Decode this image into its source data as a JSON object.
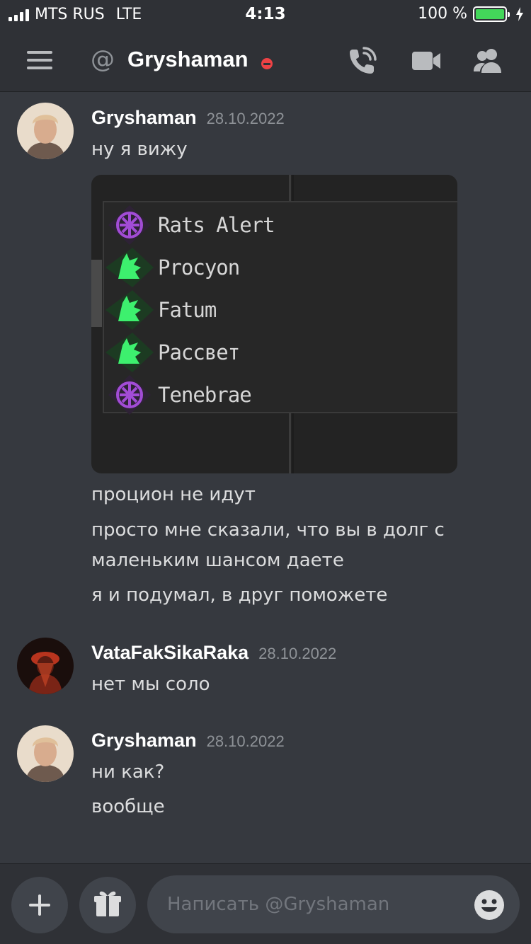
{
  "status_bar": {
    "carrier": "MTS RUS",
    "network": "LTE",
    "time": "4:13",
    "battery_text": "100 %",
    "battery_level": 1.0,
    "battery_color": "#43d65a"
  },
  "header": {
    "title": "Gryshaman",
    "status": "do-not-disturb",
    "status_color": "#ed4245",
    "icons": [
      "hamburger-icon",
      "at-icon",
      "call-icon",
      "video-icon",
      "members-icon"
    ]
  },
  "messages": [
    {
      "author": "Gryshaman",
      "timestamp": "28.10.2022",
      "lines": [
        "ну я вижу"
      ],
      "image": {
        "items": [
          {
            "name": "Rats Alert",
            "icon": "purple-rune-icon"
          },
          {
            "name": "Procyon",
            "icon": "green-wolf-icon"
          },
          {
            "name": "Fatum",
            "icon": "green-wolf-icon"
          },
          {
            "name": "Рассвет",
            "icon": "green-wolf-icon"
          },
          {
            "name": "Tenebrae",
            "icon": "purple-rune-icon"
          }
        ]
      },
      "after_image": [
        "процион не идут",
        "просто  мне сказали, что вы в долг  с маленьким шансом даете",
        "я и подумал, в друг поможете"
      ]
    },
    {
      "author": "VataFakSikaRaka",
      "timestamp": "28.10.2022",
      "lines": [
        "нет мы соло"
      ]
    },
    {
      "author": "Gryshaman",
      "timestamp": "28.10.2022",
      "lines": [
        "ни как?",
        "вообще"
      ]
    }
  ],
  "input": {
    "placeholder": "Написать @Gryshaman",
    "buttons": [
      "plus-icon",
      "gift-icon",
      "emoji-icon"
    ]
  }
}
